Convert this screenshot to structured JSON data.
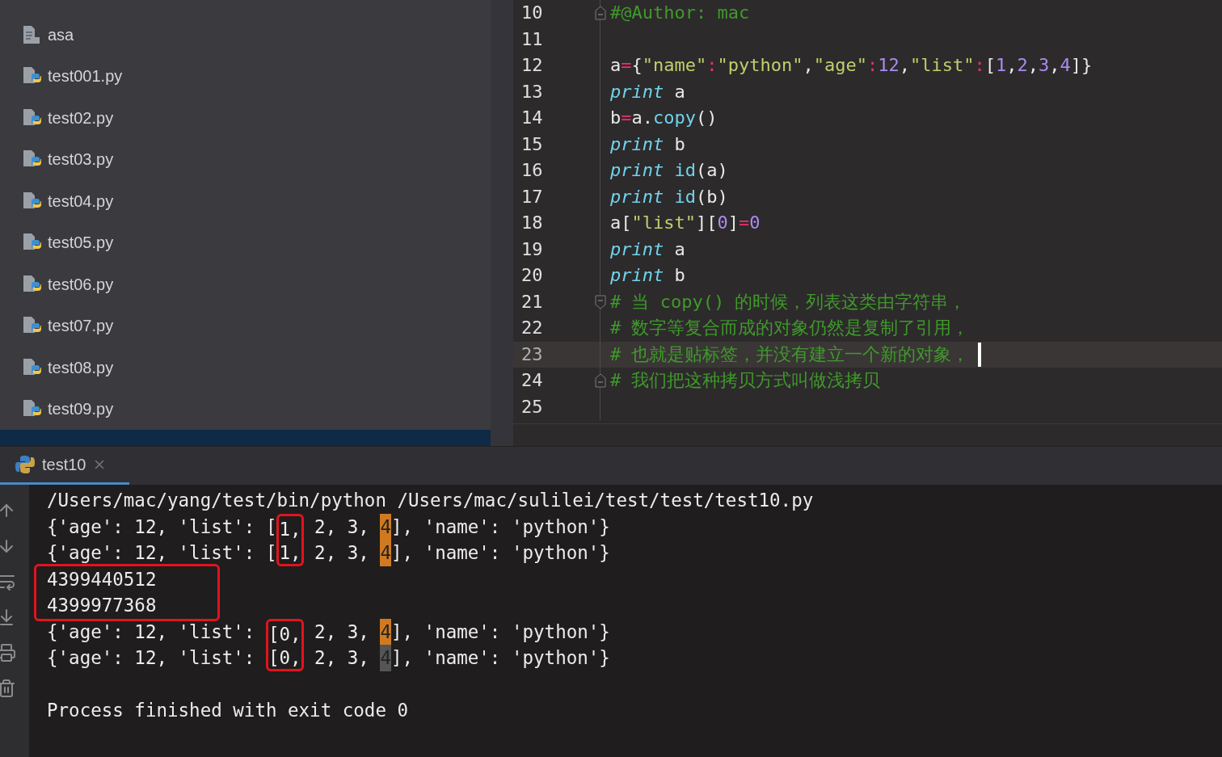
{
  "project_tree": {
    "items": [
      {
        "name": "asa",
        "kind": "text"
      },
      {
        "name": "test001.py",
        "kind": "python"
      },
      {
        "name": "test02.py",
        "kind": "python"
      },
      {
        "name": "test03.py",
        "kind": "python"
      },
      {
        "name": "test04.py",
        "kind": "python"
      },
      {
        "name": "test05.py",
        "kind": "python"
      },
      {
        "name": "test06.py",
        "kind": "python"
      },
      {
        "name": "test07.py",
        "kind": "python"
      },
      {
        "name": "test08.py",
        "kind": "python"
      },
      {
        "name": "test09.py",
        "kind": "python"
      }
    ]
  },
  "editor": {
    "lines": [
      {
        "number": "10",
        "fold_start": false,
        "fold_end": true,
        "current": false,
        "tokens": [
          {
            "text": "#@Author: mac",
            "kind": "comment"
          }
        ]
      },
      {
        "number": "11",
        "fold_start": false,
        "fold_end": false,
        "current": false
      },
      {
        "number": "12",
        "fold_start": false,
        "fold_end": false,
        "current": false,
        "tokens": [
          {
            "text": "a",
            "kind": "plain"
          },
          {
            "text": "=",
            "kind": "operator"
          },
          {
            "text": "{",
            "kind": "plain"
          },
          {
            "text": "\"name\"",
            "kind": "string"
          },
          {
            "text": ":",
            "kind": "operator"
          },
          {
            "text": "\"python\"",
            "kind": "string"
          },
          {
            "text": ",",
            "kind": "plain"
          },
          {
            "text": "\"age\"",
            "kind": "string"
          },
          {
            "text": ":",
            "kind": "operator"
          },
          {
            "text": "12",
            "kind": "number"
          },
          {
            "text": ",",
            "kind": "plain"
          },
          {
            "text": "\"list\"",
            "kind": "string"
          },
          {
            "text": ":",
            "kind": "operator"
          },
          {
            "text": "[",
            "kind": "plain"
          },
          {
            "text": "1",
            "kind": "number"
          },
          {
            "text": ",",
            "kind": "plain"
          },
          {
            "text": "2",
            "kind": "number"
          },
          {
            "text": ",",
            "kind": "plain"
          },
          {
            "text": "3",
            "kind": "number"
          },
          {
            "text": ",",
            "kind": "plain"
          },
          {
            "text": "4",
            "kind": "number"
          },
          {
            "text": "]}",
            "kind": "plain"
          }
        ]
      },
      {
        "number": "13",
        "fold_start": false,
        "fold_end": false,
        "current": false,
        "tokens": [
          {
            "text": "print",
            "kind": "keyword"
          },
          {
            "text": " a",
            "kind": "plain"
          }
        ]
      },
      {
        "number": "14",
        "fold_start": false,
        "fold_end": false,
        "current": false,
        "tokens": [
          {
            "text": "b",
            "kind": "plain"
          },
          {
            "text": "=",
            "kind": "operator"
          },
          {
            "text": "a.",
            "kind": "plain"
          },
          {
            "text": "copy",
            "kind": "builtin"
          },
          {
            "text": "()",
            "kind": "plain"
          }
        ]
      },
      {
        "number": "15",
        "fold_start": false,
        "fold_end": false,
        "current": false,
        "tokens": [
          {
            "text": "print",
            "kind": "keyword"
          },
          {
            "text": " b",
            "kind": "plain"
          }
        ]
      },
      {
        "number": "16",
        "fold_start": false,
        "fold_end": false,
        "current": false,
        "tokens": [
          {
            "text": "print",
            "kind": "keyword"
          },
          {
            "text": " id",
            "kind": "builtin"
          },
          {
            "text": "(a)",
            "kind": "plain"
          }
        ]
      },
      {
        "number": "17",
        "fold_start": false,
        "fold_end": false,
        "current": false,
        "tokens": [
          {
            "text": "print",
            "kind": "keyword"
          },
          {
            "text": " id",
            "kind": "builtin"
          },
          {
            "text": "(b)",
            "kind": "plain"
          }
        ]
      },
      {
        "number": "18",
        "fold_start": false,
        "fold_end": false,
        "current": false,
        "tokens": [
          {
            "text": "a[",
            "kind": "plain"
          },
          {
            "text": "\"list\"",
            "kind": "string"
          },
          {
            "text": "][",
            "kind": "plain"
          },
          {
            "text": "0",
            "kind": "number"
          },
          {
            "text": "]",
            "kind": "plain"
          },
          {
            "text": "=",
            "kind": "operator"
          },
          {
            "text": "0",
            "kind": "number"
          }
        ]
      },
      {
        "number": "19",
        "fold_start": false,
        "fold_end": false,
        "current": false,
        "tokens": [
          {
            "text": "print",
            "kind": "keyword"
          },
          {
            "text": " a",
            "kind": "plain"
          }
        ]
      },
      {
        "number": "20",
        "fold_start": false,
        "fold_end": false,
        "current": false,
        "tokens": [
          {
            "text": "print",
            "kind": "keyword"
          },
          {
            "text": " b",
            "kind": "plain"
          }
        ]
      },
      {
        "number": "21",
        "fold_start": true,
        "fold_end": false,
        "current": false,
        "tokens": [
          {
            "text": "# 当 copy() 的时候，列表这类由字符串，",
            "kind": "comment"
          }
        ]
      },
      {
        "number": "22",
        "fold_start": false,
        "fold_end": false,
        "current": false,
        "tokens": [
          {
            "text": "# 数字等复合而成的对象仍然是复制了引用，",
            "kind": "comment"
          }
        ]
      },
      {
        "number": "23",
        "fold_start": false,
        "fold_end": false,
        "current": true,
        "tokens": [
          {
            "text": "# 也就是贴标签，并没有建立一个新的对象，",
            "kind": "comment"
          }
        ]
      },
      {
        "number": "24",
        "fold_start": false,
        "fold_end": true,
        "current": false,
        "tokens": [
          {
            "text": "# 我们把这种拷贝方式叫做浅拷贝",
            "kind": "comment"
          }
        ]
      },
      {
        "number": "25",
        "fold_start": false,
        "fold_end": false,
        "current": false
      }
    ]
  },
  "run_panel": {
    "tabs": [
      {
        "label": "test10",
        "selected": true
      }
    ],
    "console": {
      "blocks": [
        {
          "boxed": false,
          "lines": [
            [
              {
                "text": "/Users/mac/yang/test/bin/python /Users/mac/sulilei/test/test/test10.py",
                "kind": "plain"
              }
            ],
            [
              {
                "text": "{'age': 12, 'list': [",
                "kind": "plain"
              },
              {
                "text": "1,",
                "kind": "box_top"
              },
              {
                "text": " 2, 3, ",
                "kind": "plain"
              },
              {
                "text": "4",
                "kind": "match"
              },
              {
                "text": "], 'name': 'python'}",
                "kind": "plain"
              }
            ],
            [
              {
                "text": "{'age': 12, 'list': [",
                "kind": "plain"
              },
              {
                "text": "1,",
                "kind": "box_bottom"
              },
              {
                "text": " 2, 3, ",
                "kind": "plain"
              },
              {
                "text": "4",
                "kind": "match"
              },
              {
                "text": "], 'name': 'python'}",
                "kind": "plain"
              }
            ]
          ]
        },
        {
          "boxed": true,
          "lines": [
            [
              {
                "text": "4399440512",
                "kind": "plain"
              }
            ],
            [
              {
                "text": "4399977368",
                "kind": "plain"
              }
            ]
          ]
        },
        {
          "boxed": false,
          "lines": [
            [
              {
                "text": "{'age': 12, 'list': ",
                "kind": "plain"
              },
              {
                "text": "[0,",
                "kind": "box_top"
              },
              {
                "text": " 2, 3, ",
                "kind": "plain"
              },
              {
                "text": "4",
                "kind": "match"
              },
              {
                "text": "], 'name': 'python'}",
                "kind": "plain"
              }
            ],
            [
              {
                "text": "{'age': 12, 'list': ",
                "kind": "plain"
              },
              {
                "text": "[0,",
                "kind": "box_bottom"
              },
              {
                "text": " 2, 3, ",
                "kind": "plain"
              },
              {
                "text": "4",
                "kind": "match_dim"
              },
              {
                "text": "], 'name': 'python'}",
                "kind": "plain"
              }
            ]
          ]
        }
      ],
      "exit_message": "Process finished with exit code 0"
    }
  }
}
